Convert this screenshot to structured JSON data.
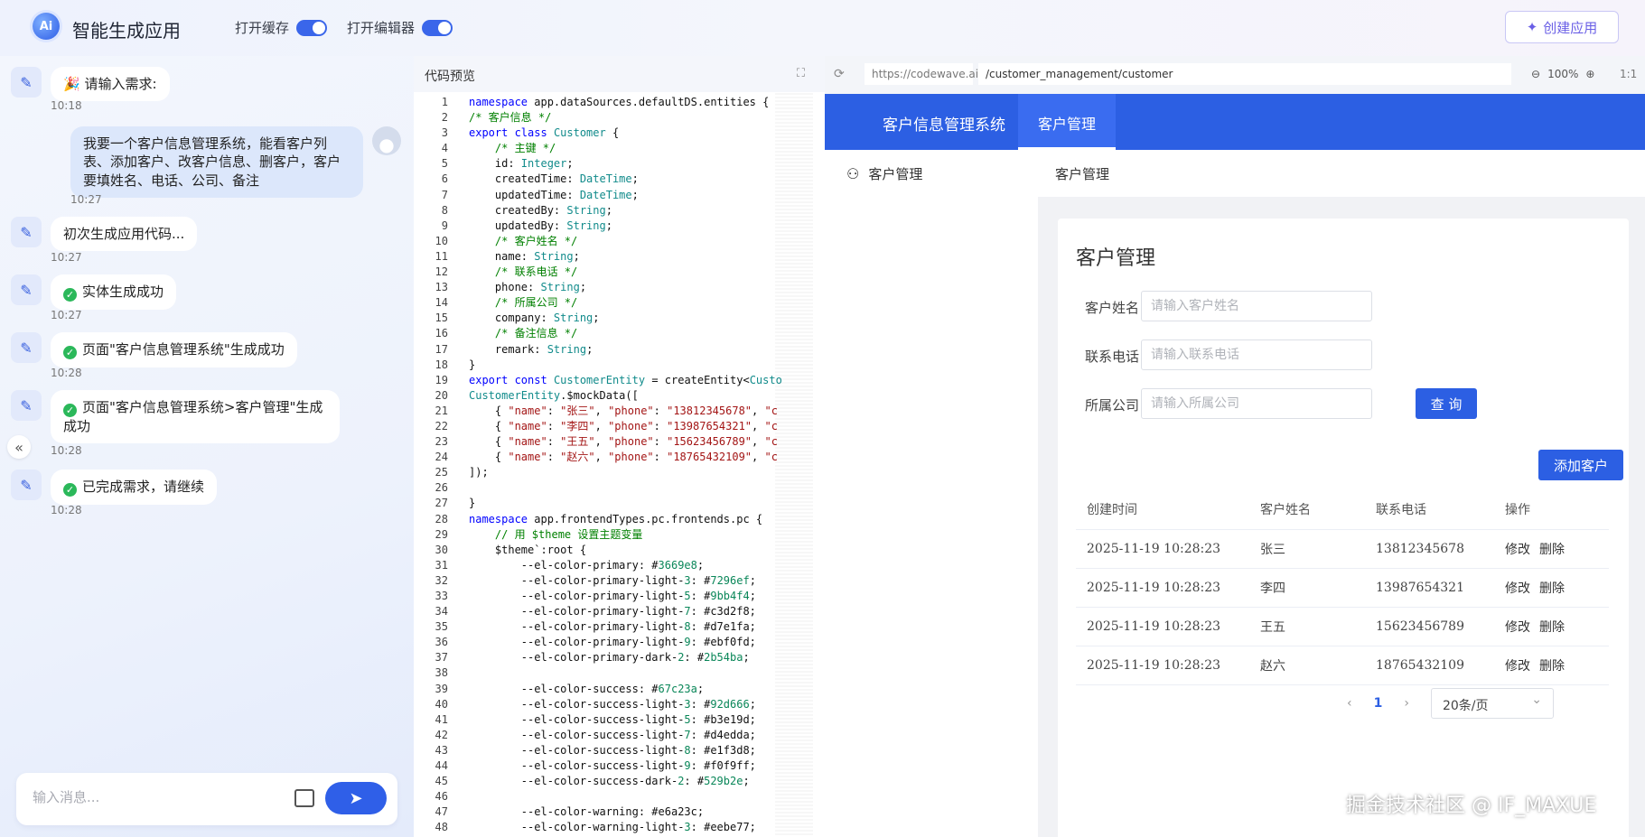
{
  "header": {
    "logo_text": "Ai",
    "title": "智能生成应用",
    "toggle_cache_label": "打开缓存",
    "toggle_editor_label": "打开编辑器",
    "create_button_label": "创建应用"
  },
  "chat": {
    "messages": [
      {
        "text": "请输入需求:",
        "time": "10:18"
      },
      {
        "text": "我要一个客户信息管理系统，能看客户列表、添加客户、改客户信息、删客户，客户要填姓名、电话、公司、备注",
        "time": "10:27"
      },
      {
        "text": "初次生成应用代码...",
        "time": "10:27"
      },
      {
        "text": "实体生成成功",
        "time": "10:27"
      },
      {
        "text": "页面\"客户信息管理系统\"生成成功",
        "time": "10:28"
      },
      {
        "text": "页面\"客户信息管理系统>客户管理\"生成成功",
        "time": "10:28"
      },
      {
        "text": "已完成需求，请继续",
        "time": "10:28"
      }
    ],
    "input_placeholder": "输入消息..."
  },
  "code_preview": {
    "title": "代码预览",
    "line_numbers": "1\n2\n3\n4\n5\n6\n7\n8\n9\n10\n11\n12\n13\n14\n15\n16\n17\n18\n19\n20\n21\n22\n23\n24\n25\n26\n27\n28\n29\n30\n31\n32\n33\n34\n35\n36\n37\n38\n39\n40\n41\n42\n43\n44\n45\n46\n47\n48"
  },
  "preview": {
    "url_host": "https://codewave.ai",
    "url_path": "/customer_management/customer",
    "zoom": "100%",
    "ratio": "1:1",
    "nav_system": "客户信息管理系统",
    "nav_tab": "客户管理",
    "side_menu_item": "客户管理",
    "breadcrumb": "客户管理",
    "card_title": "客户管理",
    "form": {
      "name_label": "客户姓名",
      "name_placeholder": "请输入客户姓名",
      "phone_label": "联系电话",
      "phone_placeholder": "请输入联系电话",
      "company_label": "所属公司",
      "company_placeholder": "请输入所属公司",
      "query_button": "查 询",
      "add_button": "添加客户"
    },
    "table": {
      "headers": [
        "创建时间",
        "客户姓名",
        "联系电话",
        "操作"
      ],
      "rows": [
        {
          "created": "2025-11-19 10:28:23",
          "name": "张三",
          "phone": "13812345678"
        },
        {
          "created": "2025-11-19 10:28:23",
          "name": "李四",
          "phone": "13987654321"
        },
        {
          "created": "2025-11-19 10:28:23",
          "name": "王五",
          "phone": "15623456789"
        },
        {
          "created": "2025-11-19 10:28:23",
          "name": "赵六",
          "phone": "18765432109"
        }
      ],
      "edit_label": "修改",
      "delete_label": "删除"
    },
    "pagination": {
      "current_page": "1",
      "page_size": "20条/页"
    }
  },
  "watermark": "掘金技术社区 @ IF_MAXUE"
}
